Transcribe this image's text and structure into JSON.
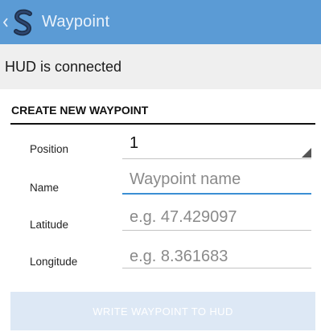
{
  "app_bar": {
    "title": "Waypoint",
    "back_icon": "chevron-left-icon",
    "logo_icon": "scubapro-s-logo-icon",
    "color": "#5b9bd5"
  },
  "status": {
    "text": "HUD is connected"
  },
  "form": {
    "section_title": "CREATE NEW WAYPOINT",
    "position": {
      "label": "Position",
      "value": "1"
    },
    "name": {
      "label": "Name",
      "placeholder": "Waypoint name",
      "value": ""
    },
    "latitude": {
      "label": "Latitude",
      "placeholder": "e.g. 47.429097",
      "value": ""
    },
    "longitude": {
      "label": "Longitude",
      "placeholder": "e.g. 8.361683",
      "value": ""
    }
  },
  "actions": {
    "write_label": "WRITE WAYPOINT TO HUD"
  },
  "colors": {
    "accent": "#3b8fd4",
    "button_disabled": "#dde8f5"
  }
}
